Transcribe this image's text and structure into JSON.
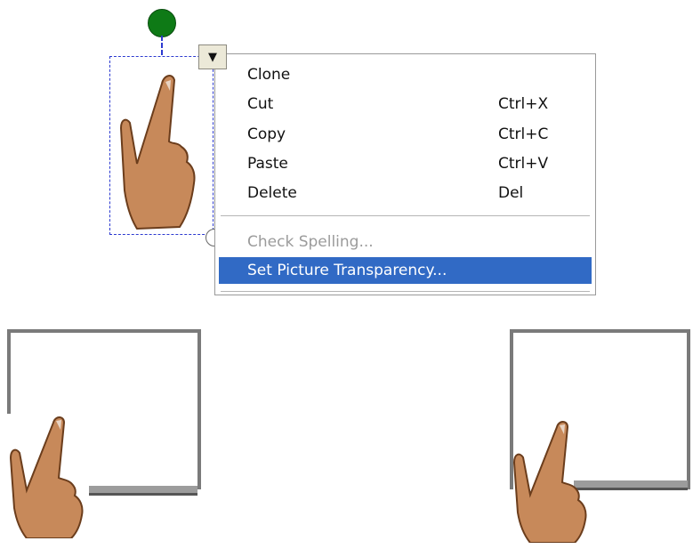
{
  "context_menu": {
    "items": [
      {
        "label": "Clone",
        "shortcut": ""
      },
      {
        "label": "Cut",
        "shortcut": "Ctrl+X"
      },
      {
        "label": "Copy",
        "shortcut": "Ctrl+C"
      },
      {
        "label": "Paste",
        "shortcut": "Ctrl+V"
      },
      {
        "label": "Delete",
        "shortcut": "Del"
      },
      {
        "label": "Check Spelling...",
        "shortcut": ""
      },
      {
        "label": "Set Picture Transparency...",
        "shortcut": ""
      }
    ]
  },
  "icons": {
    "menu_trigger": "chevron-down-icon",
    "pointing_hand": "pointing-hand-image",
    "rotation_handle": "rotation-handle-icon"
  },
  "colors": {
    "highlight": "#316ac5",
    "selection_border": "#2c3ad0",
    "rotation_handle": "#0e7a16",
    "hand_fill": "#c7895a"
  }
}
